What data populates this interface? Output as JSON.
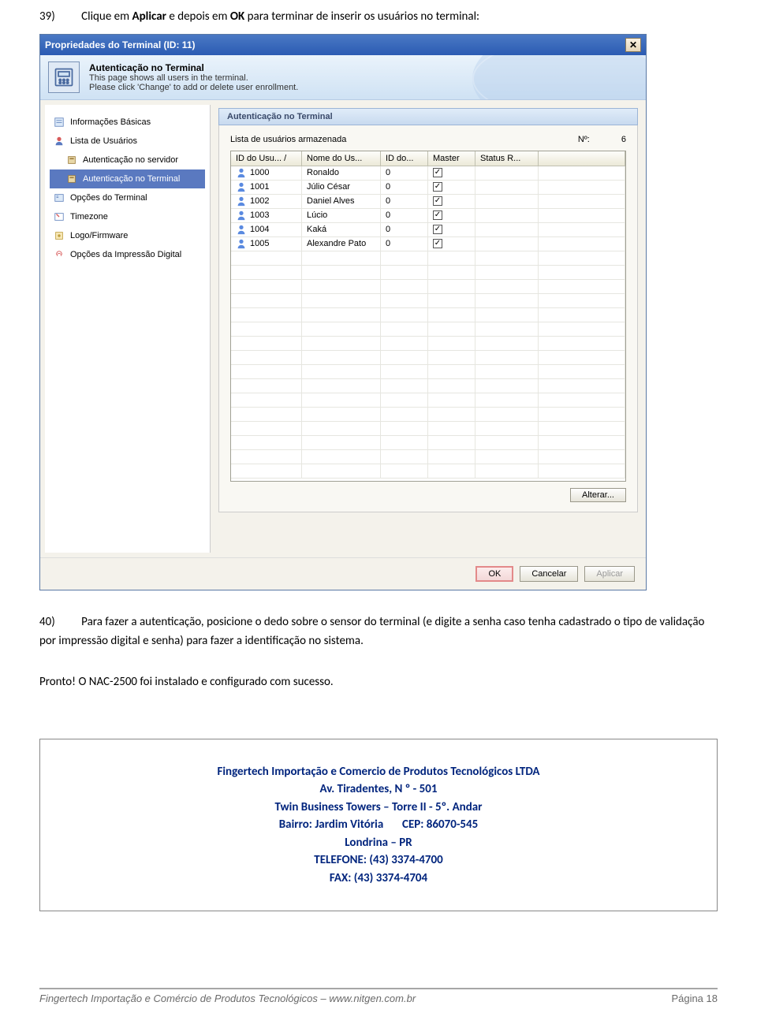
{
  "step39": {
    "num": "39)",
    "pre": "Clique em ",
    "b1": "Aplicar",
    "mid": " e depois em ",
    "b2": "OK",
    "post": " para terminar de inserir os usuários no terminal:"
  },
  "window": {
    "title": "Propriedades do Terminal (ID: 11)",
    "banner": {
      "title": "Autenticação no Terminal",
      "line1": "This page shows all users in the terminal.",
      "line2": "Please click 'Change' to add or delete user enrollment."
    },
    "sidebar": [
      {
        "label": "Informações Básicas",
        "icon": "info"
      },
      {
        "label": "Lista de Usuários",
        "icon": "users"
      },
      {
        "label": "Autenticação no servidor",
        "icon": "auth",
        "indent": true
      },
      {
        "label": "Autenticação no Terminal",
        "icon": "auth",
        "indent": true,
        "selected": true
      },
      {
        "label": "Opções do Terminal",
        "icon": "opts"
      },
      {
        "label": "Timezone",
        "icon": "tz"
      },
      {
        "label": "Logo/Firmware",
        "icon": "fw"
      },
      {
        "label": "Opções da Impressão Digital",
        "icon": "fp"
      }
    ],
    "panel": {
      "title": "Autenticação no Terminal",
      "list_label": "Lista de usuários armazenada",
      "count_label": "Nº:",
      "count_value": "6",
      "columns": [
        "ID do Usu... /",
        "Nome do Us...",
        "ID do...",
        "Master",
        "Status R..."
      ],
      "rows": [
        {
          "id": "1000",
          "name": "Ronaldo",
          "gid": "0",
          "master": true
        },
        {
          "id": "1001",
          "name": "Júlio César",
          "gid": "0",
          "master": true
        },
        {
          "id": "1002",
          "name": "Daniel Alves",
          "gid": "0",
          "master": true
        },
        {
          "id": "1003",
          "name": "Lúcio",
          "gid": "0",
          "master": true
        },
        {
          "id": "1004",
          "name": "Kaká",
          "gid": "0",
          "master": true
        },
        {
          "id": "1005",
          "name": "Alexandre Pato",
          "gid": "0",
          "master": true
        }
      ],
      "alterar": "Alterar..."
    },
    "footer": {
      "ok": "OK",
      "cancel": "Cancelar",
      "apply": "Aplicar"
    }
  },
  "step40": {
    "num": "40)",
    "text": "Para fazer a autenticação, posicione o dedo sobre o sensor do terminal (e digite a senha caso tenha cadastrado o tipo de validação por impressão digital e senha) para fazer a identificação no sistema."
  },
  "pronto": "Pronto! O NAC-2500 foi instalado e configurado com sucesso.",
  "contact": {
    "l1": "Fingertech Importação e Comercio de Produtos Tecnológicos LTDA",
    "l2": "Av. Tiradentes, N º - 501",
    "l3": "Twin Business Towers – Torre II - 5º. Andar",
    "l4a": "Bairro: Jardim Vitória",
    "l4b": "CEP: 86070-545",
    "l5": "Londrina – PR",
    "l6": "TELEFONE: (43) 3374-4700",
    "l7": "FAX: (43) 3374-4704"
  },
  "footer": {
    "left": "Fingertech Importação e Comércio de Produtos Tecnológicos – www.nitgen.com.br",
    "right": "Página 18"
  }
}
